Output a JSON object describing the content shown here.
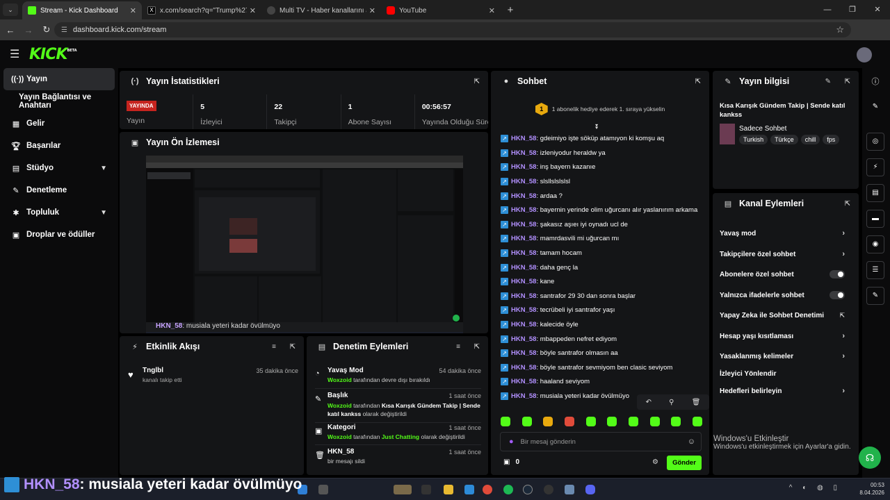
{
  "browser": {
    "tabs": [
      {
        "title": "Stream - Kick Dashboard",
        "color": "#53fc18",
        "active": true
      },
      {
        "title": "x.com/search?q=\"Trump%27in",
        "color": "#000000",
        "active": false
      },
      {
        "title": "Multi TV - Haber kanallarını ay",
        "color": "#444444",
        "active": false
      },
      {
        "title": "YouTube",
        "color": "#ff0000",
        "active": false
      }
    ],
    "url": "dashboard.kick.com/stream",
    "profile_initial": "S"
  },
  "kick": {
    "logo": "KICK",
    "logo_badge": "BETA"
  },
  "sidebar": {
    "items": [
      {
        "label": "Yayın",
        "icon": "broadcast-icon"
      },
      {
        "label": "Yayın Bağlantısı ve Anahtarı",
        "icon": ""
      },
      {
        "label": "Gelir",
        "icon": "money-icon"
      },
      {
        "label": "Başarılar",
        "icon": "trophy-icon"
      },
      {
        "label": "Stüdyo",
        "icon": "studio-icon"
      },
      {
        "label": "Denetleme",
        "icon": "wrench-icon"
      },
      {
        "label": "Topluluk",
        "icon": "community-icon"
      },
      {
        "label": "Droplar ve ödüller",
        "icon": "gift-icon"
      }
    ]
  },
  "stats": {
    "title": "Yayın İstatistikleri",
    "live_badge": "YAYINDA",
    "status_label": "Yayın",
    "cells": [
      {
        "value": "5",
        "label": "İzleyici"
      },
      {
        "value": "22",
        "label": "Takipçi"
      },
      {
        "value": "1",
        "label": "Abone Sayısı"
      },
      {
        "value": "00:56:57",
        "label": "Yayında Olduğu Süre"
      }
    ]
  },
  "preview": {
    "title": "Yayın Ön İzlemesi",
    "caption_user": "HKN_58",
    "caption_text": ": musiala yeteri kadar övülmüyo"
  },
  "activity": {
    "title": "Etkinlik Akışı",
    "events": [
      {
        "user": "Tnglbl",
        "desc": "kanalı takip etti",
        "time": "35 dakika önce"
      }
    ]
  },
  "moderation": {
    "title": "Denetim Eylemleri",
    "events": [
      {
        "title": "Yavaş Mod",
        "time": "54 dakika önce",
        "actor": "Woxzoid",
        "text": " tarafından devre dışı bırakıldı",
        "value": "",
        "suffix": ""
      },
      {
        "title": "Başlık",
        "time": "1 saat önce",
        "actor": "Woxzoid",
        "text": " tarafından ",
        "value": "Kısa Karışık Gündem Takip | Sende katıl kankss",
        "suffix": " olarak değiştirildi"
      },
      {
        "title": "Kategori",
        "time": "1 saat önce",
        "actor": "Woxzoid",
        "text": " tarafından ",
        "value": "Just Chatting",
        "suffix": " olarak değiştirildi"
      },
      {
        "title": "HKN_58",
        "time": "1 saat önce",
        "actor": "",
        "text": "bir mesajı sildi",
        "value": "",
        "suffix": ""
      }
    ]
  },
  "chat": {
    "title": "Sohbet",
    "pinned": "1 abonelik hediye ederek 1. sıraya yükselin",
    "pinned_rank": "1",
    "messages": [
      {
        "user": "HKN_58",
        "text": "gdeimiyo işte söküp atamıyon ki komşu aq"
      },
      {
        "user": "HKN_58",
        "text": "izleniyodur heraldw ya"
      },
      {
        "user": "HKN_58",
        "text": "inş bayern kazanıe"
      },
      {
        "user": "HKN_58",
        "text": "slsllslslslsl"
      },
      {
        "user": "HKN_58",
        "text": "ardaa ?"
      },
      {
        "user": "HKN_58",
        "text": "bayernin yerinde olim uğurcanı alır yaslanırım arkama"
      },
      {
        "user": "HKN_58",
        "text": "şakasız aşıeı iyi oynadı ucl de"
      },
      {
        "user": "HKN_58",
        "text": "mamrdasvili mi uğurcan mı"
      },
      {
        "user": "HKN_58",
        "text": "tamam hocam"
      },
      {
        "user": "HKN_58",
        "text": "daha genç la"
      },
      {
        "user": "HKN_58",
        "text": "kane"
      },
      {
        "user": "HKN_58",
        "text": "santrafor 29 30 dan sonra başlar"
      },
      {
        "user": "HKN_58",
        "text": "tecrübeli iyi santrafor yaşı"
      },
      {
        "user": "HKN_58",
        "text": "kalecide öyle"
      },
      {
        "user": "HKN_58",
        "text": "mbappeden nefret ediyom"
      },
      {
        "user": "HKN_58",
        "text": "böyle santrafor olmasın aa"
      },
      {
        "user": "HKN_58",
        "text": "böyle santrafor sevmiyom ben clasic seviyom"
      },
      {
        "user": "HKN_58",
        "text": "haaland seviyom"
      },
      {
        "user": "HKN_58",
        "text": "musiala yeteri kadar övülmüyo"
      }
    ],
    "input_placeholder": "Bir mesaj gönderin",
    "points": "0",
    "send_label": "Gönder"
  },
  "stream_info": {
    "title": "Yayın bilgisi",
    "stream_title": "Kısa Karışık Gündem Takip | Sende katıl kankss",
    "category": "Sadece Sohbet",
    "tags": [
      "Turkish",
      "Türkçe",
      "chill",
      "fps"
    ]
  },
  "channel_actions": {
    "title": "Kanal Eylemleri",
    "items": [
      {
        "label": "Yavaş mod",
        "control": "chevron"
      },
      {
        "label": "Takipçilere özel sohbet",
        "control": "chevron"
      },
      {
        "label": "Abonelere özel sohbet",
        "control": "toggle"
      },
      {
        "label": "Yalnızca ifadelerle sohbet",
        "control": "toggle"
      },
      {
        "label": "Yapay Zeka ile Sohbet Denetimi",
        "control": "external"
      },
      {
        "label": "Hesap yaşı kısıtlaması",
        "control": "chevron"
      },
      {
        "label": "Yasaklanmış kelimeler",
        "control": "chevron"
      },
      {
        "label": "İzleyici Yönlendir",
        "control": "none"
      },
      {
        "label": "Hedefleri belirleyin",
        "control": "chevron"
      }
    ]
  },
  "windows": {
    "activate_title": "Windows'u Etkinleştir",
    "activate_sub": "Windows'u etkinleştirmek için Ayarlar'a gidin.",
    "time": "00:53",
    "date": "8.04.2026"
  },
  "overlay": {
    "user": "HKN_58",
    "text": " : musiala yeteri kadar övülmüyo"
  }
}
